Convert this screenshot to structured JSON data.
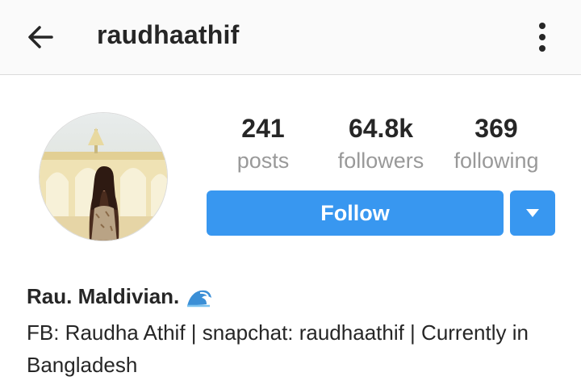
{
  "header": {
    "title": "raudhaathif",
    "back_icon": "arrow-left-icon",
    "menu_icon": "more-vertical-icon"
  },
  "profile": {
    "avatar_icon": "profile-photo"
  },
  "stats": [
    {
      "value": "241",
      "label": "posts"
    },
    {
      "value": "64.8k",
      "label": "followers"
    },
    {
      "value": "369",
      "label": "following"
    }
  ],
  "actions": {
    "follow_label": "Follow",
    "dropdown_icon": "caret-down-icon"
  },
  "bio": {
    "name": "Rau. Maldivian.",
    "name_emoji": "wave-emoji",
    "text": "FB: Raudha Athif | snapchat: raudhaathif | Currently in Bangladesh"
  },
  "colors": {
    "accent": "#3897f0",
    "text": "#262626",
    "muted": "#999999",
    "header_bg": "#fafafa"
  }
}
